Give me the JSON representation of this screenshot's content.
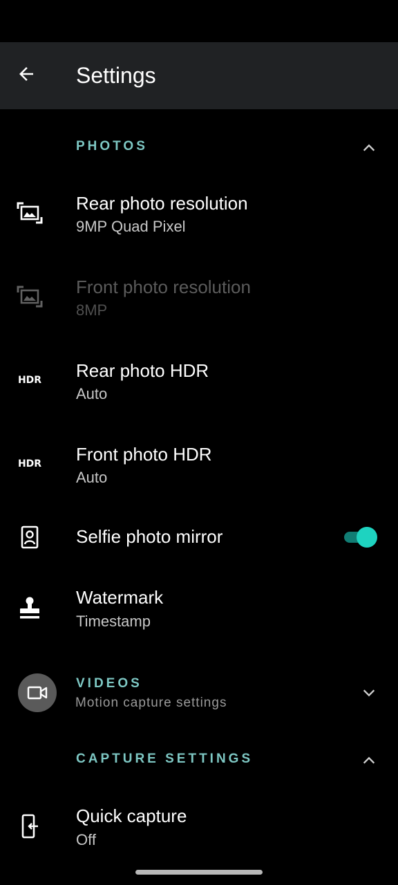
{
  "app_bar": {
    "title": "Settings",
    "back_icon": "arrow-back-icon"
  },
  "sections": {
    "photos": {
      "title": "PHOTOS",
      "expanded": true,
      "chevron_icon": "chevron-up-icon"
    },
    "videos": {
      "title": "VIDEOS",
      "subtitle": "Motion capture settings",
      "expanded": false,
      "icon": "video-camera-icon",
      "chevron_icon": "chevron-down-icon"
    },
    "capture": {
      "title": "CAPTURE SETTINGS",
      "expanded": true,
      "chevron_icon": "chevron-up-icon"
    }
  },
  "photos": {
    "rear_resolution": {
      "title": "Rear photo resolution",
      "summary": "9MP Quad Pixel",
      "icon": "photo-size-icon",
      "enabled": true
    },
    "front_resolution": {
      "title": "Front photo resolution",
      "summary": "8MP",
      "icon": "photo-size-icon",
      "enabled": false
    },
    "rear_hdr": {
      "title": "Rear photo HDR",
      "summary": "Auto",
      "icon_text": "HDR",
      "icon": "hdr-icon"
    },
    "front_hdr": {
      "title": "Front photo HDR",
      "summary": "Auto",
      "icon_text": "HDR",
      "icon": "hdr-icon"
    },
    "selfie_mirror": {
      "title": "Selfie photo mirror",
      "icon": "portrait-frame-icon",
      "toggle_on": true
    },
    "watermark": {
      "title": "Watermark",
      "summary": "Timestamp",
      "icon": "stamp-icon"
    }
  },
  "capture": {
    "quick_capture": {
      "title": "Quick capture",
      "summary": "Off",
      "icon": "phone-twist-icon"
    }
  },
  "colors": {
    "accent_text": "#7ec8c4",
    "toggle_thumb": "#1ed3c0",
    "toggle_track": "#117d74",
    "app_bar_bg": "#202224",
    "background": "#000000"
  }
}
